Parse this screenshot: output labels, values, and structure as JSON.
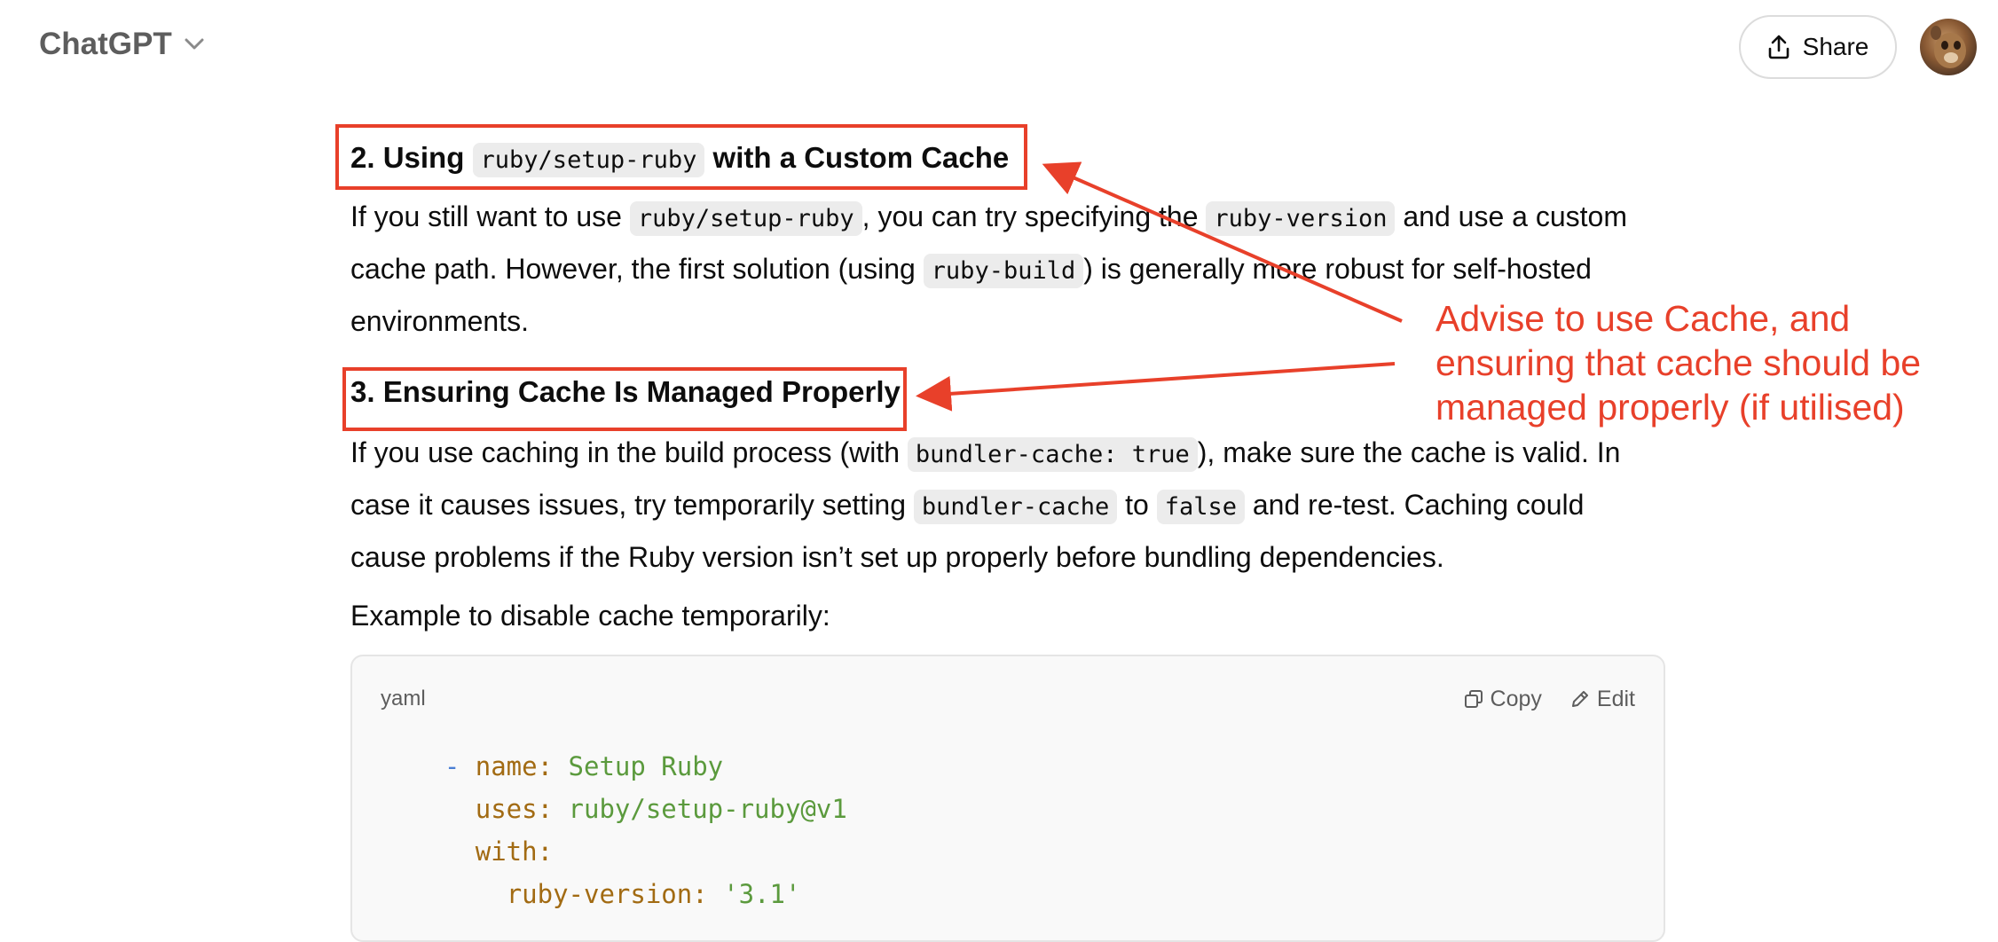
{
  "header": {
    "app_title": "ChatGPT",
    "share_label": "Share"
  },
  "section2": {
    "heading_prefix": "2. Using ",
    "heading_code": "ruby/setup-ruby",
    "heading_suffix": " with a Custom Cache",
    "p_1": "If you still want to use ",
    "p_code1": "ruby/setup-ruby",
    "p_2": ", you can try specifying the ",
    "p_code2": "ruby-version",
    "p_3": " and use a custom cache path. However, the first solution (using ",
    "p_code3": "ruby-build",
    "p_4": ") is generally more robust for self-hosted environments."
  },
  "section3": {
    "heading": "3. Ensuring Cache Is Managed Properly",
    "p_1": "If you use caching in the build process (with ",
    "p_code1": "bundler-cache: true",
    "p_2": "), make sure the cache is valid. In case it causes issues, try temporarily setting ",
    "p_code2": "bundler-cache",
    "p_3": " to ",
    "p_code3": "false",
    "p_4": " and re-test. Caching could cause problems if the Ruby version isn’t set up properly before bundling dependencies."
  },
  "example_label": "Example to disable cache temporarily:",
  "code_block": {
    "language": "yaml",
    "copy_label": "Copy",
    "edit_label": "Edit",
    "line1_dash": "- ",
    "line1_key": "name",
    "line1_colon": ": ",
    "line1_val": "Setup Ruby",
    "line2_key": "uses",
    "line2_colon": ": ",
    "line2_val": "ruby/setup-ruby@v1",
    "line3_key": "with",
    "line3_colon": ":",
    "line4_key": "ruby-version",
    "line4_colon": ": ",
    "line4_val": "'3.1'"
  },
  "annotation": {
    "text": "Advise to use Cache, and ensuring that cache should be managed properly (if utilised)",
    "color": "#e8402a"
  }
}
